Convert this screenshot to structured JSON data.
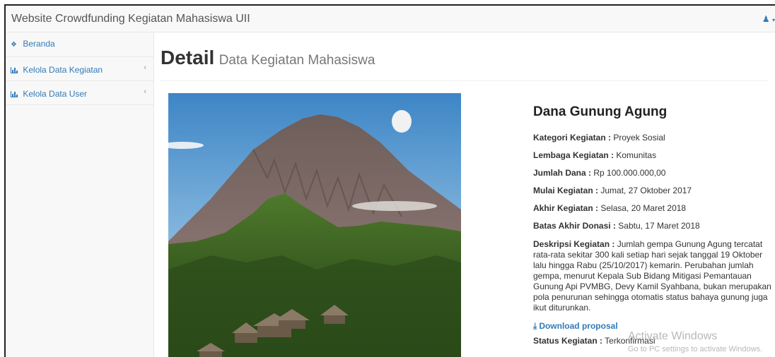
{
  "navbar": {
    "brand": "Website Crowdfunding Kegiatan Mahasiswa UII",
    "user_icon": "user-icon",
    "caret_icon": "caret-down-icon"
  },
  "sidebar": {
    "items": [
      {
        "label": "Beranda",
        "icon": "home-icon"
      },
      {
        "label": "Kelola Data Kegiatan",
        "icon": "bar-chart-icon",
        "chevron": "‹"
      },
      {
        "label": "Kelola Data User",
        "icon": "bar-chart-icon",
        "chevron": "‹"
      }
    ]
  },
  "header": {
    "title": "Detail",
    "subtitle": "Data Kegiatan Mahasiswa"
  },
  "detail": {
    "name": "Dana Gunung Agung",
    "fields": [
      {
        "label": "Kategori Kegiatan :",
        "value": "Proyek Sosial"
      },
      {
        "label": "Lembaga Kegiatan :",
        "value": "Komunitas"
      },
      {
        "label": "Jumlah Dana :",
        "value": "Rp 100.000.000,00"
      },
      {
        "label": "Mulai Kegiatan :",
        "value": "Jumat, 27 Oktober 2017"
      },
      {
        "label": "Akhir Kegiatan :",
        "value": "Selasa, 20 Maret 2018"
      },
      {
        "label": "Batas Akhir Donasi :",
        "value": "Sabtu, 17 Maret 2018"
      }
    ],
    "description_label": "Deskripsi Kegiatan :",
    "description": "Jumlah gempa Gunung Agung tercatat rata-rata sekitar 300 kali setiap hari sejak tanggal 19 Oktober lalu hingga Rabu (25/10/2017) kemarin. Perubahan jumlah gempa, menurut Kepala Sub Bidang Mitigasi Pemantauan Gunung Api PVMBG, Devy Kamil Syahbana, bukan merupakan pola penurunan sehingga otomatis status bahaya gunung juga ikut diturunkan.",
    "download_label": "Download proposal",
    "download_icon": "download-icon",
    "status_label": "Status Kegiatan :",
    "status_value": "Terkonfirmasi"
  },
  "watermark": {
    "line1": "Activate Windows",
    "line2": "Go to PC settings to activate Windows."
  },
  "colors": {
    "link": "#337ab7",
    "navbar_bg": "#f8f8f8",
    "border": "#e7e7e7"
  }
}
